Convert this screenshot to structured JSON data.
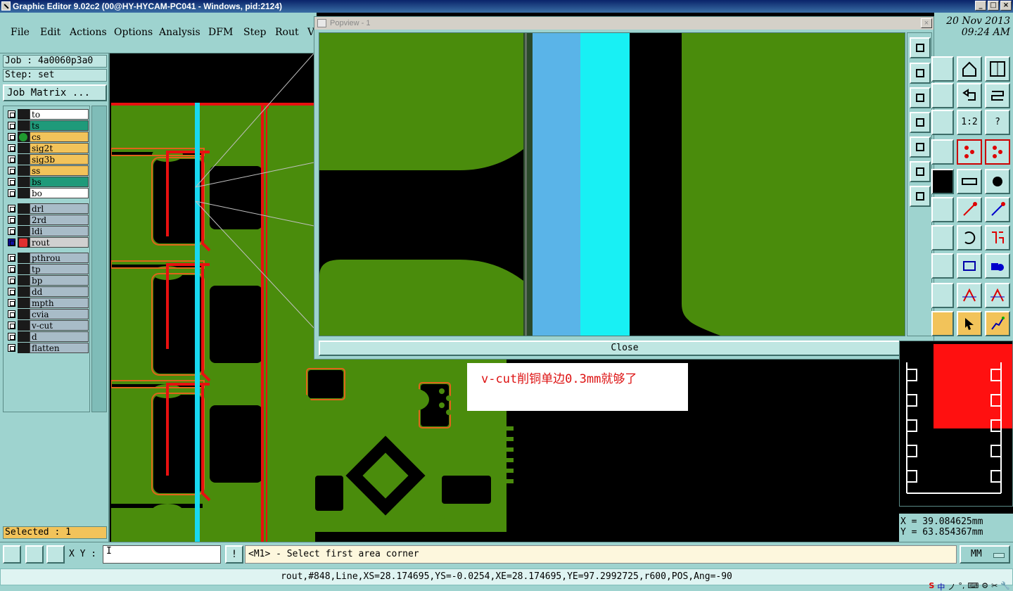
{
  "window": {
    "title": "Graphic Editor 9.02c2 (00@HY-HYCAM-PC041 - Windows, pid:2124)",
    "min_label": "_",
    "max_label": "□",
    "close_label": "×"
  },
  "menu": {
    "items": [
      "File",
      "Edit",
      "Actions",
      "Options",
      "Analysis",
      "DFM",
      "Step",
      "Rout",
      "V"
    ]
  },
  "job": {
    "job_line": "Job : 4a0060p3a0",
    "step_line": "Step: set",
    "matrix_button": "Job Matrix ..."
  },
  "layers": [
    {
      "name": "to",
      "color": "#ffffff"
    },
    {
      "name": "ts",
      "color": "#1f9a7a"
    },
    {
      "name": "cs",
      "color": "#f2c35a",
      "active": true
    },
    {
      "name": "sig2t",
      "color": "#f2c35a"
    },
    {
      "name": "sig3b",
      "color": "#f2c35a"
    },
    {
      "name": "ss",
      "color": "#f2c35a"
    },
    {
      "name": "bs",
      "color": "#1f9a7a"
    },
    {
      "name": "bo",
      "color": "#ffffff"
    },
    {
      "name": "drl",
      "color": "#a8bcc8"
    },
    {
      "name": "2rd",
      "color": "#a8bcc8"
    },
    {
      "name": "ldi",
      "color": "#a8bcc8"
    },
    {
      "name": "rout",
      "color": "#d0d0d0",
      "work": true
    },
    {
      "name": "pthrou",
      "color": "#a8bcc8"
    },
    {
      "name": "tp",
      "color": "#a8bcc8"
    },
    {
      "name": "bp",
      "color": "#a8bcc8"
    },
    {
      "name": "dd",
      "color": "#a8bcc8"
    },
    {
      "name": "mpth",
      "color": "#a8bcc8"
    },
    {
      "name": "cvia",
      "color": "#a8bcc8"
    },
    {
      "name": "v-cut",
      "color": "#a8bcc8"
    },
    {
      "name": "d",
      "color": "#a8bcc8"
    },
    {
      "name": "flatten",
      "color": "#a8bcc8"
    }
  ],
  "selected": "Selected : 1",
  "popview": {
    "title": "Popview - 1",
    "close_x": "×",
    "close_button": "Close"
  },
  "date": {
    "line1": "20 Nov 2013",
    "line2": "09:24 AM"
  },
  "right_tools": {
    "ratio_label": "1:2",
    "help_label": "?"
  },
  "annotation": "v-cut削铜单边0.3mm就够了",
  "coords": {
    "x": "X = 39.084625mm",
    "y": "Y = 63.854367mm"
  },
  "command": {
    "xy_label": "X Y :",
    "xy_value": "I",
    "excl": "!",
    "message": "<M1> - Select first area corner",
    "units": "MM"
  },
  "status": "rout,#848,Line,XS=28.174695,YS=-0.0254,XE=28.174695,YE=97.2992725,r600,POS,Ang=-90",
  "tray": [
    "S",
    "中",
    "ノ",
    "°,",
    "⌨",
    "⚙",
    "✂",
    "🔧"
  ],
  "colors": {
    "copper": "#4a8c0c",
    "trace_red": "#e81010",
    "vcut_cyan": "#18d8f0",
    "panel_teal": "#9ed3cf"
  }
}
